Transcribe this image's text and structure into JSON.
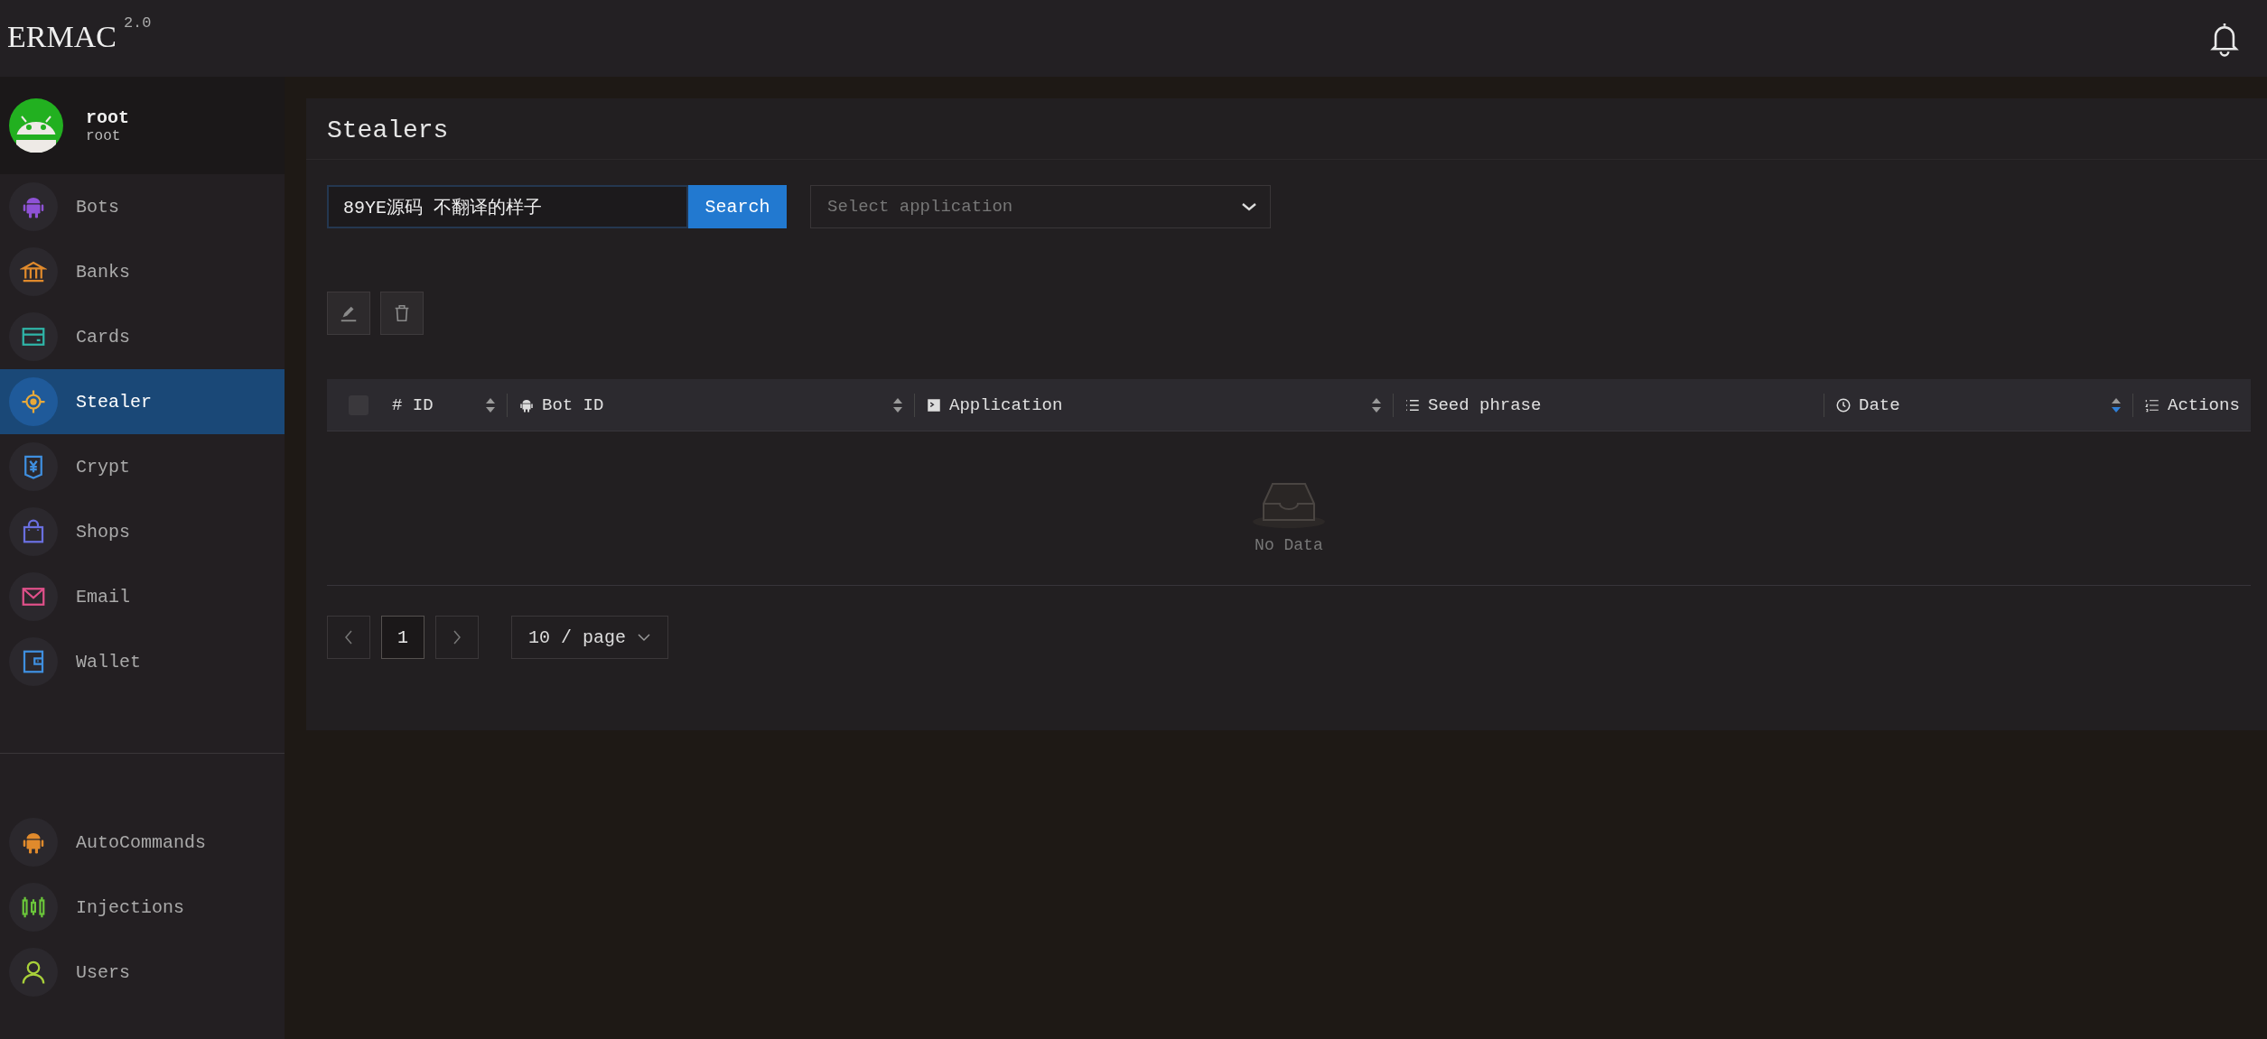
{
  "app": {
    "name": "ERMAC",
    "version": "2.0"
  },
  "user": {
    "name": "root",
    "role": "root"
  },
  "sidebar": {
    "groups": [
      {
        "items": [
          {
            "label": "Bots",
            "kind": "android",
            "color": "#8e52d6",
            "selected": false
          },
          {
            "label": "Banks",
            "kind": "bank",
            "color": "#e08a2c",
            "selected": false
          },
          {
            "label": "Cards",
            "kind": "card",
            "color": "#2fb5a8",
            "selected": false
          },
          {
            "label": "Stealer",
            "kind": "target",
            "color": "#e8a93a",
            "selected": true
          },
          {
            "label": "Crypt",
            "kind": "yen",
            "color": "#3f8fe0",
            "selected": false
          },
          {
            "label": "Shops",
            "kind": "bag",
            "color": "#6a6fe0",
            "selected": false
          },
          {
            "label": "Email",
            "kind": "mail",
            "color": "#e0508a",
            "selected": false
          },
          {
            "label": "Wallet",
            "kind": "wallet",
            "color": "#3f8fe0",
            "selected": false
          }
        ]
      },
      {
        "items": [
          {
            "label": "AutoCommands",
            "kind": "android",
            "color": "#e08a2c",
            "selected": false
          },
          {
            "label": "Injections",
            "kind": "candles",
            "color": "#6ac53a",
            "selected": false
          },
          {
            "label": "Users",
            "kind": "user",
            "color": "#a8d03a",
            "selected": false
          }
        ]
      }
    ]
  },
  "page": {
    "title": "Stealers",
    "search": {
      "value": "89YE源码 不翻译的样子",
      "button": "Search"
    },
    "select": {
      "placeholder": "Select application"
    },
    "table": {
      "columns": [
        {
          "label": "# ID",
          "kind": "plain",
          "sortable": true,
          "sorted_descending": false
        },
        {
          "label": "Bot ID",
          "kind": "android",
          "sortable": true,
          "sorted_descending": false
        },
        {
          "label": "Application",
          "kind": "terminal",
          "sortable": true,
          "sorted_descending": false
        },
        {
          "label": "Seed phrase",
          "kind": "list",
          "sortable": false
        },
        {
          "label": "Date",
          "kind": "clock",
          "sortable": true,
          "sorted_descending": true
        },
        {
          "label": "Actions",
          "kind": "olist",
          "sortable": false
        }
      ],
      "select_all": {
        "checked": false
      },
      "empty": "No Data"
    },
    "pagination": {
      "pages": [
        {
          "label": "1",
          "selected": true
        }
      ],
      "page_size": "10 / page"
    }
  }
}
